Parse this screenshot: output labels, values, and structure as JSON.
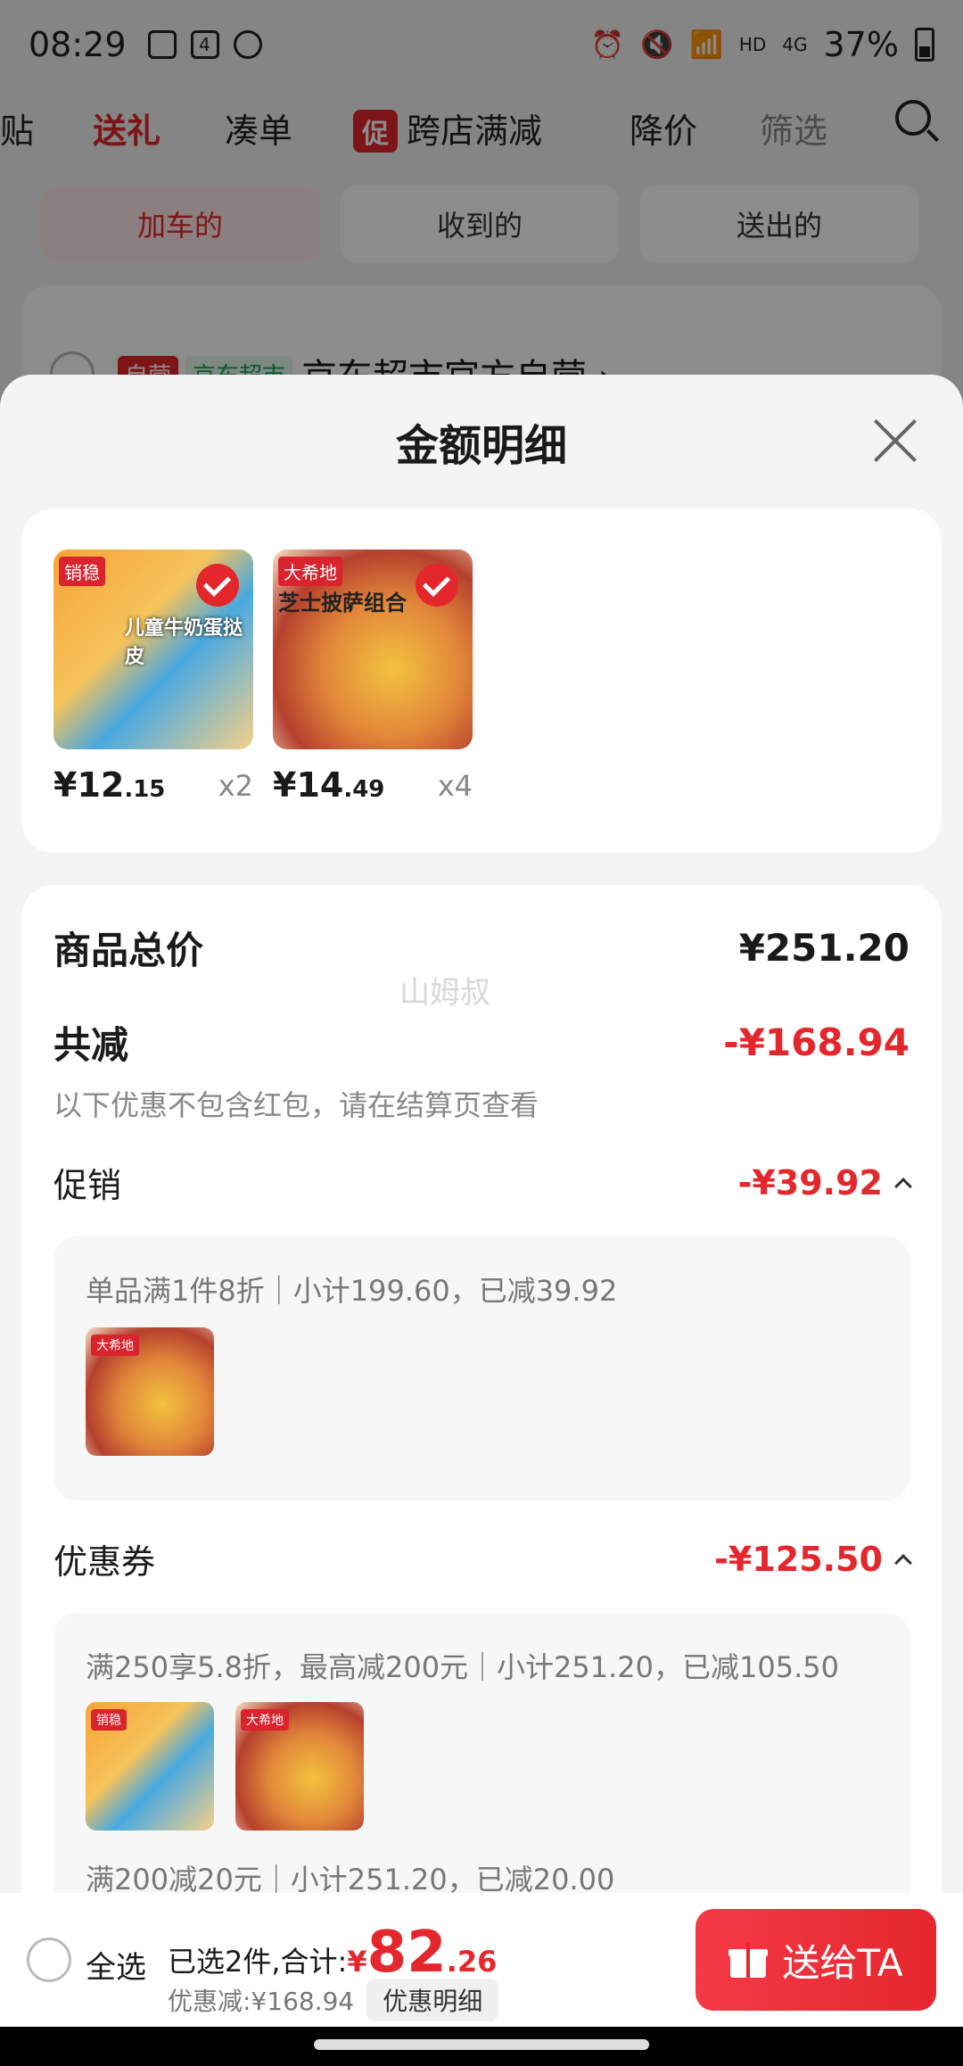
{
  "status_bar": {
    "time": "08:29",
    "notif_count": "4",
    "network": "HD",
    "signal_type": "4G",
    "battery": "37%"
  },
  "top_nav": {
    "items": [
      "贴",
      "送礼",
      "凑单",
      "跨店满减",
      "降价",
      "筛选"
    ],
    "promo_badge": "促"
  },
  "seg_tabs": [
    "加车的",
    "收到的",
    "送出的"
  ],
  "bg_shop": {
    "tag_self": "自营",
    "tag_market": "京东超市",
    "name": "京东超市官方自营 ›"
  },
  "sheet": {
    "title": "金额明细",
    "products": [
      {
        "price_int": "¥12",
        "price_dec": ".15",
        "qty": "x2",
        "img_label": "销稳",
        "img_text": "儿童牛奶蛋挞皮"
      },
      {
        "price_int": "¥14",
        "price_dec": ".49",
        "qty": "x4",
        "img_label": "大希地",
        "img_text": "芝士披萨组合"
      }
    ],
    "total_label": "商品总价",
    "total_value": "¥251.20",
    "reduce_label": "共减",
    "reduce_value": "-¥168.94",
    "reduce_note": "以下优惠不包含红包，请在结算页查看",
    "promo_label": "促销",
    "promo_value": "-¥39.92",
    "promo_detail": "单品满1件8折｜小计199.60，已减39.92",
    "coupon_label": "优惠券",
    "coupon_value": "-¥125.50",
    "coupon_detail_1": "满250享5.8折，最高减200元｜小计251.20，已减105.50",
    "coupon_detail_2": "满200减20元｜小计251.20，已减20.00",
    "watermark": "山姆叔"
  },
  "bottom_bar": {
    "select_all": "全选",
    "selected_text": "已选2件,合计:",
    "currency": "¥",
    "total_int": "82",
    "total_dec": ".26",
    "discount_text": "优惠减:¥168.94",
    "detail_btn": "优惠明细",
    "send_btn": "送给TA"
  }
}
